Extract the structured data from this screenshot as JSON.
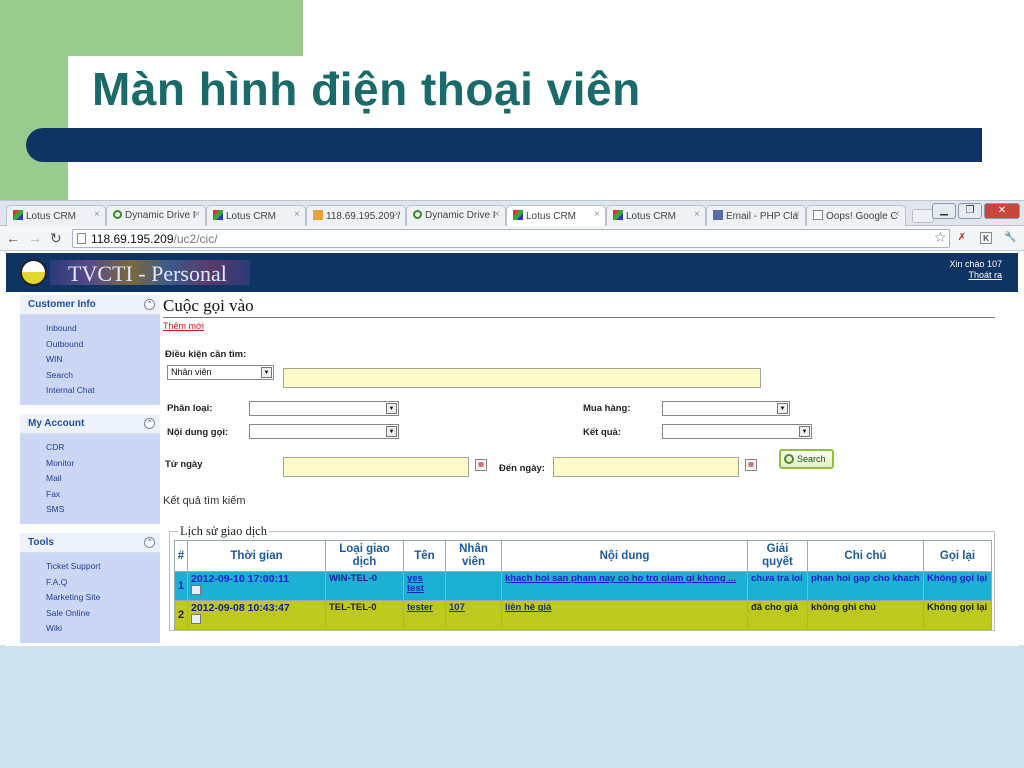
{
  "slide": {
    "title": "Màn hình điện thoại viên"
  },
  "browser": {
    "tabs": [
      {
        "label": "Lotus CRM",
        "icon": "lotus-icon"
      },
      {
        "label": "Dynamic Drive I",
        "icon": "dd-icon"
      },
      {
        "label": "Lotus CRM",
        "icon": "lotus-icon"
      },
      {
        "label": "118.69.195.209 /",
        "icon": "pma-icon"
      },
      {
        "label": "Dynamic Drive I",
        "icon": "dd-icon"
      },
      {
        "label": "Lotus CRM",
        "icon": "lotus-icon",
        "active": true
      },
      {
        "label": "Lotus CRM",
        "icon": "lotus-icon"
      },
      {
        "label": "Email - PHP Cla",
        "icon": "php-icon"
      },
      {
        "label": "Oops! Google C",
        "icon": "doc-icon"
      }
    ],
    "url_host": "118.69.195.209",
    "url_path": "/uc2/cic/"
  },
  "header": {
    "logo_text": "TVCTI - Personal",
    "greeting": "Xin chào 107",
    "logout": "Thoát ra"
  },
  "sidebar": {
    "customer_info": {
      "title": "Customer Info",
      "items": [
        "Inbound",
        "Outbound",
        "WIN",
        "Search",
        "Internal Chat"
      ]
    },
    "my_account": {
      "title": "My Account",
      "items": [
        "CDR",
        "Monitor",
        "Mail",
        "Fax",
        "SMS"
      ]
    },
    "tools": {
      "title": "Tools",
      "items": [
        "Ticket Support",
        "F.A.Q",
        "Marketing Site",
        "Sale Online",
        "Wiki"
      ]
    }
  },
  "content": {
    "title": "Cuộc gọi vào",
    "add_new": "Thêm mới",
    "search_condition_label": "Điều kiện cần tìm:",
    "search_field_value": "Nhân viên",
    "category_label": "Phân loại:",
    "call_content_label": "Nội dung gọi:",
    "purchase_label": "Mua hàng:",
    "result_label": "Kết quả:",
    "from_date_label": "Từ ngày",
    "to_date_label": "Đến ngày:",
    "search_button": "Search",
    "results_title": "Kết quả tìm kiếm",
    "history_title": "Lịch sử giao dịch"
  },
  "table": {
    "headers": [
      "#",
      "Thời gian",
      "Loại giao dịch",
      "Tên",
      "Nhân viên",
      "Nội dung",
      "Giải quyết",
      "Chi chú",
      "Gọi lại"
    ],
    "rows": [
      {
        "num": "1",
        "time": "2012-09-10 17:00:11",
        "type": "WIN-TEL-0",
        "name": "yes test",
        "staff": "",
        "content": "khach hoi san pham nay co ho tro giam gi khong ...",
        "resolve": "chưa tra loi",
        "note": "phan hoi gap cho khach",
        "callback": "Không gọi lại"
      },
      {
        "num": "2",
        "time": "2012-09-08 10:43:47",
        "type": "TEL-TEL-0",
        "name": "tester",
        "staff": "107",
        "content": "liên hê giá",
        "resolve": "đã cho giá",
        "note": "không ghi chú",
        "callback": "Không gọi lại"
      }
    ]
  },
  "colors": {
    "header_bg": "#0e3463",
    "row1_bg": "#1cb0d2",
    "row2_bg": "#bdc91f",
    "title_color": "#1a6a6a"
  }
}
